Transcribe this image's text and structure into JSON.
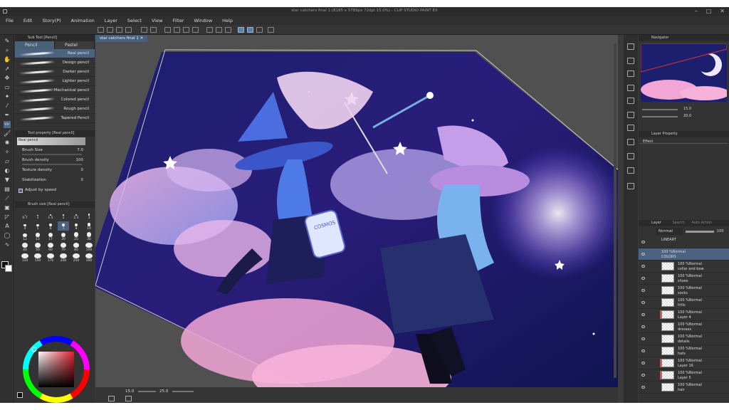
{
  "window": {
    "title": "star catchers final 1 (8185 x 5789px 72dpi 15.0%) - CLIP STUDIO PAINT EX"
  },
  "menu": [
    "File",
    "Edit",
    "Story(P)",
    "Animation",
    "Layer",
    "Select",
    "View",
    "Filter",
    "Window",
    "Help"
  ],
  "subtool": {
    "header": "Sub Tool [Pencil]",
    "tabs": [
      "Pencil",
      "Pastel"
    ],
    "brushes": [
      "Real pencil",
      "Design pencil",
      "Darker pencil",
      "Lighter pencil",
      "Mechanical pencil",
      "Colored pencil",
      "Rough pencil",
      "Tapered Pencil"
    ]
  },
  "tool_property": {
    "header": "Tool property [Real pencil]",
    "preset": "Real pencil",
    "brush_size_label": "Brush Size",
    "brush_size_value": "7.0",
    "brush_density_label": "Brush density",
    "brush_density_value": "100",
    "texture_density_label": "Texture density",
    "texture_density_value": "0",
    "stabilization_label": "Stabilization",
    "stabilization_value": "0",
    "adjust_speed_label": "Adjust by speed"
  },
  "brush_size_panel": {
    "header": "Brush size [Real pencil]",
    "sizes": [
      "0.7",
      "1",
      "1.5",
      "2",
      "2.5",
      "3",
      "4",
      "5",
      "6",
      "7",
      "8",
      "10",
      "12",
      "15",
      "17",
      "20",
      "25",
      "30",
      "40",
      "50",
      "60",
      "70",
      "80",
      "100",
      "120",
      "150",
      "170",
      "200",
      "250",
      "300"
    ],
    "selected": "7"
  },
  "canvas": {
    "doc_tab": "star catchers final 1",
    "zoom": "15.0",
    "rotation": "25.0",
    "jar_label": "COSMOS"
  },
  "navigator": {
    "header": "Navigator",
    "zoom": "15.0",
    "angle": "20.0"
  },
  "layer_property": {
    "header": "Layer Property",
    "effect_label": "Effect"
  },
  "layers": {
    "header": "Layer",
    "tabs": [
      "Layer",
      "Search",
      "Auto Action"
    ],
    "blend_mode": "Normal",
    "opacity": "100",
    "items": [
      {
        "title": "LINEART",
        "subtitle": "",
        "mark": ""
      },
      {
        "title": "100 %Normal",
        "subtitle": "COLORS",
        "mark": ""
      },
      {
        "title": "100 %Normal",
        "subtitle": "collar and bow",
        "mark": ""
      },
      {
        "title": "100 %Normal",
        "subtitle": "shoes",
        "mark": ""
      },
      {
        "title": "100 %Normal",
        "subtitle": "socks",
        "mark": ""
      },
      {
        "title": "100 %Normal",
        "subtitle": "frills",
        "mark": ""
      },
      {
        "title": "100 %Normal",
        "subtitle": "Layer 4",
        "mark": "#d95050"
      },
      {
        "title": "100 %Normal",
        "subtitle": "dresses",
        "mark": ""
      },
      {
        "title": "100 %Normal",
        "subtitle": "details",
        "mark": ""
      },
      {
        "title": "100 %Normal",
        "subtitle": "hats",
        "mark": ""
      },
      {
        "title": "100 %Normal",
        "subtitle": "Layer 16",
        "mark": "#d95050"
      },
      {
        "title": "100 %Normal",
        "subtitle": "Layer 5",
        "mark": "#d95050"
      },
      {
        "title": "100 %Normal",
        "subtitle": "hair",
        "mark": ""
      }
    ]
  },
  "colors": {
    "accent": "#4b6281",
    "app_bg": "#3a3a3a",
    "canvas_bg": "#505050"
  }
}
